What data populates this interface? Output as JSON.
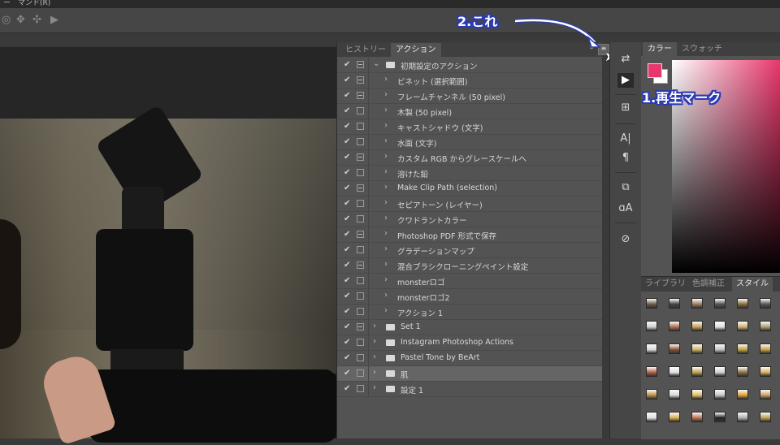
{
  "menubar": {
    "text": "ー　マンド(R)"
  },
  "options_bar": {
    "icons": [
      "orbit-icon",
      "rotate-icon",
      "move-3d-icon",
      "video-camera-icon"
    ]
  },
  "actions_panel": {
    "tabs": [
      "ヒストリー",
      "アクション"
    ],
    "active_tab": "アクション",
    "collapse_label": "»",
    "menu_icon": "panel-menu-icon",
    "rows": [
      {
        "label": "初期設定のアクション",
        "check": true,
        "dialog": "on",
        "type": "set",
        "expanded": true
      },
      {
        "label": "ビネット (選択範囲)",
        "check": true,
        "dialog": "on",
        "type": "action"
      },
      {
        "label": "フレームチャンネル (50 pixel)",
        "check": true,
        "dialog": "on",
        "type": "action"
      },
      {
        "label": "木製 (50 pixel)",
        "check": true,
        "dialog": "off",
        "type": "action"
      },
      {
        "label": "キャストシャドウ (文字)",
        "check": true,
        "dialog": "off",
        "type": "action"
      },
      {
        "label": "水面 (文字)",
        "check": true,
        "dialog": "off",
        "type": "action"
      },
      {
        "label": "カスタム RGB からグレースケールへ",
        "check": true,
        "dialog": "on",
        "type": "action"
      },
      {
        "label": "溶けた鉛",
        "check": true,
        "dialog": "off",
        "type": "action"
      },
      {
        "label": "Make Clip Path (selection)",
        "check": true,
        "dialog": "on",
        "type": "action"
      },
      {
        "label": "セピアトーン (レイヤー)",
        "check": true,
        "dialog": "off",
        "type": "action"
      },
      {
        "label": "クワドラントカラー",
        "check": true,
        "dialog": "off",
        "type": "action"
      },
      {
        "label": "Photoshop PDF 形式で保存",
        "check": true,
        "dialog": "on",
        "type": "action"
      },
      {
        "label": "グラデーションマップ",
        "check": true,
        "dialog": "off",
        "type": "action"
      },
      {
        "label": "混合ブラシクローニングペイント設定",
        "check": true,
        "dialog": "on",
        "type": "action"
      },
      {
        "label": "monsterロゴ",
        "check": true,
        "dialog": "off",
        "type": "action"
      },
      {
        "label": "monsterロゴ2",
        "check": true,
        "dialog": "off",
        "type": "action"
      },
      {
        "label": "アクション 1",
        "check": true,
        "dialog": "off",
        "type": "action"
      },
      {
        "label": "Set 1",
        "check": true,
        "dialog": "on",
        "type": "set"
      },
      {
        "label": "Instagram Photoshop Actions",
        "check": true,
        "dialog": "off",
        "type": "set"
      },
      {
        "label": "Pastel Tone by BeArt",
        "check": true,
        "dialog": "off",
        "type": "set"
      },
      {
        "label": "肌",
        "check": true,
        "dialog": "off",
        "type": "set",
        "selected": true
      },
      {
        "label": "設定 1",
        "check": true,
        "dialog": "off",
        "type": "set"
      }
    ]
  },
  "annotations": {
    "menu_callout": "2.これ",
    "play_callout": "1.再生マーク"
  },
  "toolstrip": {
    "tools": [
      "history-brush-icon",
      "play-icon",
      "info-icon",
      "character-icon",
      "paragraph-icon",
      "clone-source-icon",
      "glyphs-icon",
      "properties-icon"
    ]
  },
  "color_panel": {
    "tabs": [
      "カラー",
      "スウォッチ"
    ],
    "active_tab": "カラー",
    "foreground": "#e8376b",
    "background": "#ffffff"
  },
  "styles_panel": {
    "tabs": [
      "ライブラリ",
      "色調補正",
      "スタイル"
    ],
    "active_tab": "スタイル"
  }
}
